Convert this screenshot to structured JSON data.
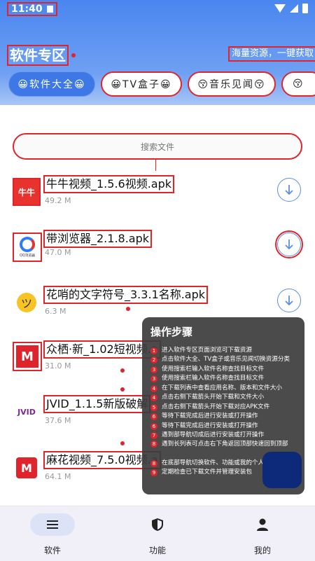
{
  "status_bar": {
    "time": "11:40"
  },
  "header": {
    "title": "软件专区",
    "slogan": "海量资源，一键获取"
  },
  "categories": [
    {
      "label": "😀软件大全😀",
      "active": true
    },
    {
      "label": "😀TV盒子😀",
      "active": false
    },
    {
      "label": "😚音乐见闻😚",
      "active": false
    },
    {
      "label": "😚",
      "active": false
    }
  ],
  "search": {
    "placeholder": "搜索文件"
  },
  "files": [
    {
      "name": "牛牛视频_1.5.6视频.apk",
      "size": "49.2 M",
      "icon": "niuniu-logo",
      "icon_text": "牛牛"
    },
    {
      "name": "带浏览器_2.1.8.apk",
      "size": "47.0 M",
      "icon": "browser-logo",
      "icon_text": "QQ浏览器"
    },
    {
      "name": "花哨的文字符号_3.3.1名称.apk",
      "size": "6.3 M",
      "icon": "smiley-logo",
      "icon_text": "ツ"
    },
    {
      "name": "众栖·新_1.02短视频.a",
      "size": "31.0 M",
      "icon": "m-logo",
      "icon_text": "M"
    },
    {
      "name": "JVID_1.1.5新版破解",
      "size": "37.6 M",
      "icon": "jvid-logo",
      "icon_text": "JVID"
    },
    {
      "name": "麻花视频_7.5.0视频.a",
      "size": "64.1 M",
      "icon": "mahua-logo",
      "icon_text": "M"
    }
  ],
  "steps_panel": {
    "title": "操作步骤",
    "steps": [
      {
        "num": "1",
        "text": "进入软件专区页面浏览可下载资源"
      },
      {
        "num": "2",
        "text": "点击软件大全、TV盒子或音乐见闻切换资源分类"
      },
      {
        "num": "3",
        "text": "使用搜索栏输入软件名称查找目标文件"
      },
      {
        "num": "3",
        "text": "使用搜索栏输入软件名称查找目标文件"
      },
      {
        "num": "4",
        "text": "在下载列表中查看应用名称、版本和文件大小"
      },
      {
        "num": "4",
        "text": "点击右侧下载箭头开始下载和文件大小"
      },
      {
        "num": "5",
        "text": "点击右侧下载箭头开始下载对应APK文件"
      },
      {
        "num": "6",
        "text": "等待下载完成后进行安装或打开操作"
      },
      {
        "num": "6",
        "text": "等待下载完成后进行安装或打开操作"
      },
      {
        "num": "7",
        "text": "遇到部导航切成后进行安装或打开操作"
      },
      {
        "num": "8",
        "text": "遇到长列表可点击右下角返回顶部快速回到顶部"
      },
      {
        "num": "8",
        "text": "在底部导航切换软件、功能或我的个人中心"
      },
      {
        "num": "9",
        "text": "定期检查已下载文件并管理安装包"
      }
    ]
  },
  "bottom_nav": [
    {
      "label": "软件",
      "icon": "menu-icon",
      "active": true
    },
    {
      "label": "功能",
      "icon": "shield-icon",
      "active": false
    },
    {
      "label": "我的",
      "icon": "person-icon",
      "active": false
    }
  ],
  "colors": {
    "header_blue": "#4a86f0",
    "active_tab": "#3d78e6",
    "annotation_red": "#e0242c",
    "download_blue": "#5a8fe6"
  }
}
